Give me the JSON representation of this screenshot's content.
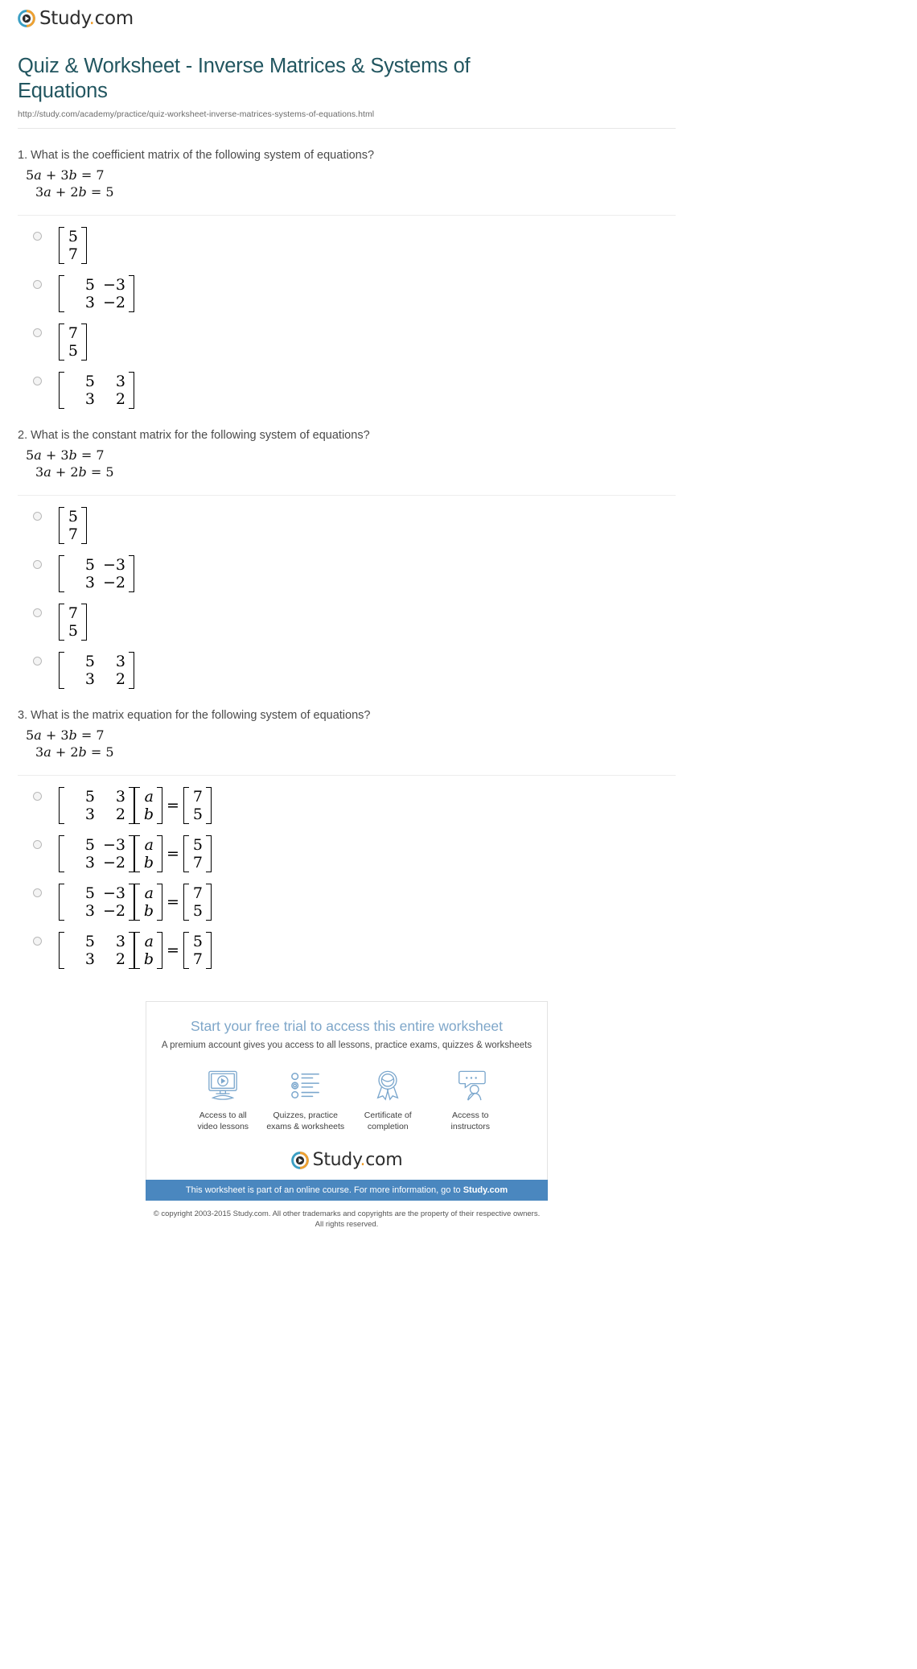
{
  "brand": {
    "name_prefix": "Study",
    "name_dot": ".",
    "name_suffix": "com"
  },
  "header": {
    "title": "Quiz & Worksheet - Inverse Matrices & Systems of Equations",
    "url": "http://study.com/academy/practice/quiz-worksheet-inverse-matrices-systems-of-equations.html"
  },
  "questions": [
    {
      "number": "1.",
      "prompt": "1. What is the coefficient matrix of the following system of equations?",
      "equations": [
        "5a + 3b = 7",
        "3a + 2b = 5"
      ],
      "answers": [
        {
          "rows": [
            [
              "5"
            ],
            [
              "7"
            ]
          ],
          "width": "w1"
        },
        {
          "rows": [
            [
              "5",
              "−3"
            ],
            [
              "3",
              "−2"
            ]
          ],
          "width": "w2"
        },
        {
          "rows": [
            [
              "7"
            ],
            [
              "5"
            ]
          ],
          "width": "w1"
        },
        {
          "rows": [
            [
              "5",
              "3"
            ],
            [
              "3",
              "2"
            ]
          ],
          "width": "w2"
        }
      ]
    },
    {
      "number": "2.",
      "prompt": "2. What is the constant matrix for the following system of equations?",
      "equations": [
        "5a + 3b = 7",
        "3a + 2b = 5"
      ],
      "answers": [
        {
          "rows": [
            [
              "5"
            ],
            [
              "7"
            ]
          ],
          "width": "w1"
        },
        {
          "rows": [
            [
              "5",
              "−3"
            ],
            [
              "3",
              "−2"
            ]
          ],
          "width": "w2"
        },
        {
          "rows": [
            [
              "7"
            ],
            [
              "5"
            ]
          ],
          "width": "w1"
        },
        {
          "rows": [
            [
              "5",
              "3"
            ],
            [
              "3",
              "2"
            ]
          ],
          "width": "w2"
        }
      ]
    },
    {
      "number": "3.",
      "prompt": "3. What is the matrix equation for the following system of equations?",
      "equations": [
        "5a + 3b = 7",
        "3a + 2b = 5"
      ],
      "answers": [
        {
          "coeff": {
            "rows": [
              [
                "5",
                "3"
              ],
              [
                "3",
                "2"
              ]
            ],
            "width": "w2"
          },
          "vars": {
            "rows": [
              [
                "a"
              ],
              [
                "b"
              ]
            ],
            "width": "w1",
            "italic": true
          },
          "equals": "=",
          "consts": {
            "rows": [
              [
                "7"
              ],
              [
                "5"
              ]
            ],
            "width": "w1"
          }
        },
        {
          "coeff": {
            "rows": [
              [
                "5",
                "−3"
              ],
              [
                "3",
                "−2"
              ]
            ],
            "width": "w2"
          },
          "vars": {
            "rows": [
              [
                "a"
              ],
              [
                "b"
              ]
            ],
            "width": "w1",
            "italic": true
          },
          "equals": "=",
          "consts": {
            "rows": [
              [
                "5"
              ],
              [
                "7"
              ]
            ],
            "width": "w1"
          }
        },
        {
          "coeff": {
            "rows": [
              [
                "5",
                "−3"
              ],
              [
                "3",
                "−2"
              ]
            ],
            "width": "w2"
          },
          "vars": {
            "rows": [
              [
                "a"
              ],
              [
                "b"
              ]
            ],
            "width": "w1",
            "italic": true
          },
          "equals": "=",
          "consts": {
            "rows": [
              [
                "7"
              ],
              [
                "5"
              ]
            ],
            "width": "w1"
          }
        },
        {
          "coeff": {
            "rows": [
              [
                "5",
                "3"
              ],
              [
                "3",
                "2"
              ]
            ],
            "width": "w2"
          },
          "vars": {
            "rows": [
              [
                "a"
              ],
              [
                "b"
              ]
            ],
            "width": "w1",
            "italic": true
          },
          "equals": "=",
          "consts": {
            "rows": [
              [
                "5"
              ],
              [
                "7"
              ]
            ],
            "width": "w1"
          }
        }
      ]
    }
  ],
  "promo": {
    "title": "Start your free trial to access this entire worksheet",
    "subtitle": "A premium account gives you access to all lessons, practice exams, quizzes & worksheets",
    "features": [
      {
        "icon": "monitor-play-icon",
        "line1": "Access to all",
        "line2": "video lessons"
      },
      {
        "icon": "checklist-icon",
        "line1": "Quizzes, practice",
        "line2": "exams & worksheets"
      },
      {
        "icon": "award-ribbon-icon",
        "line1": "Certificate of",
        "line2": "completion"
      },
      {
        "icon": "instructor-chat-icon",
        "line1": "Access to",
        "line2": "instructors"
      }
    ],
    "bar_text": "This worksheet is part of an online course. For more information, go to ",
    "bar_link": "Study.com",
    "copyright_line1": "© copyright 2003-2015 Study.com. All other trademarks and copyrights are the property of their respective owners.",
    "copyright_line2": "All rights reserved."
  },
  "colors": {
    "title": "#225660",
    "promo_title": "#7ea6c9",
    "bar": "#4a87bf",
    "logo_accent": "#f0a030",
    "logo_ring": "#3b9fc4"
  }
}
